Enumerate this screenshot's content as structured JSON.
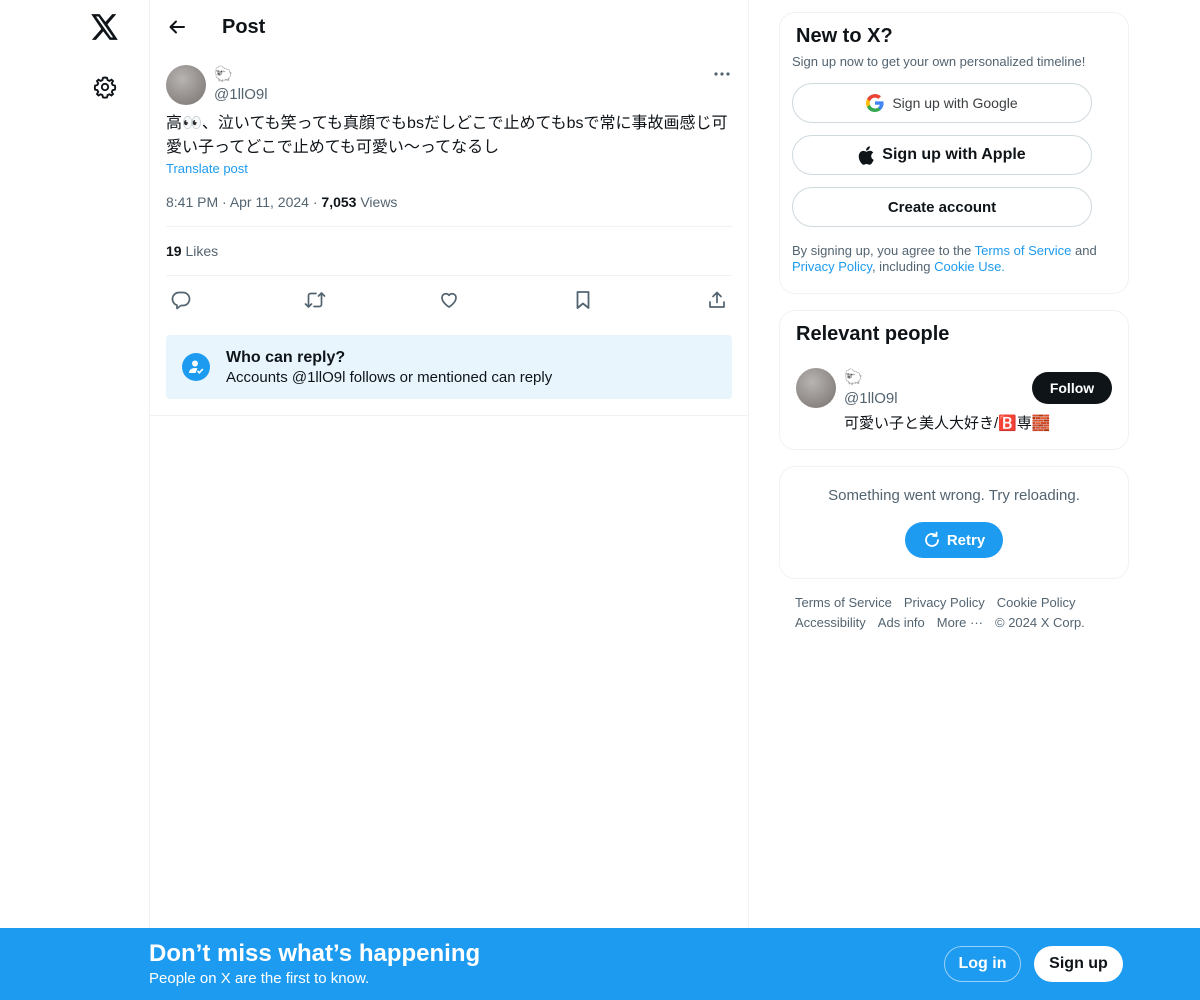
{
  "header": {
    "title": "Post"
  },
  "post": {
    "author_name": "🐑",
    "author_handle": "@1llO9l",
    "text": "高👀、泣いても笑っても真顔でもbsだしどこで止めてもbsで常に事故画感じ可愛い子ってどこで止めても可愛い〜ってなるし",
    "translate_label": "Translate post",
    "time": "8:41 PM",
    "date": "Apr 11, 2024",
    "views_count": "7,053",
    "views_label": "Views",
    "likes_count": "19",
    "likes_label": "Likes",
    "reply_title": "Who can reply?",
    "reply_sub": "Accounts @1llO9l follows or mentioned can reply"
  },
  "signup": {
    "title": "New to X?",
    "subtitle": "Sign up now to get your own personalized timeline!",
    "google_label": "Sign up with Google",
    "apple_label": "Sign up with Apple",
    "create_label": "Create account",
    "legal_prefix": "By signing up, you agree to the ",
    "terms": "Terms of Service",
    "and": " and",
    "privacy": "Privacy Policy",
    "including": ", including ",
    "cookie": "Cookie Use."
  },
  "relevant": {
    "title": "Relevant people",
    "name": "🐑",
    "handle": "@1llO9l",
    "bio": "可愛い子と美人大好き/🅱️専🧱",
    "follow_label": "Follow"
  },
  "error": {
    "message": "Something went wrong. Try reloading.",
    "retry_label": "Retry"
  },
  "footer": {
    "links": [
      "Terms of Service",
      "Privacy Policy",
      "Cookie Policy",
      "Accessibility",
      "Ads info",
      "More ···",
      "© 2024 X Corp."
    ]
  },
  "bottom": {
    "title": "Don’t miss what’s happening",
    "subtitle": "People on X are the first to know.",
    "login_label": "Log in",
    "signup_label": "Sign up"
  },
  "colors": {
    "accent": "#1d9bf0",
    "text": "#0f1419",
    "muted": "#536471"
  }
}
